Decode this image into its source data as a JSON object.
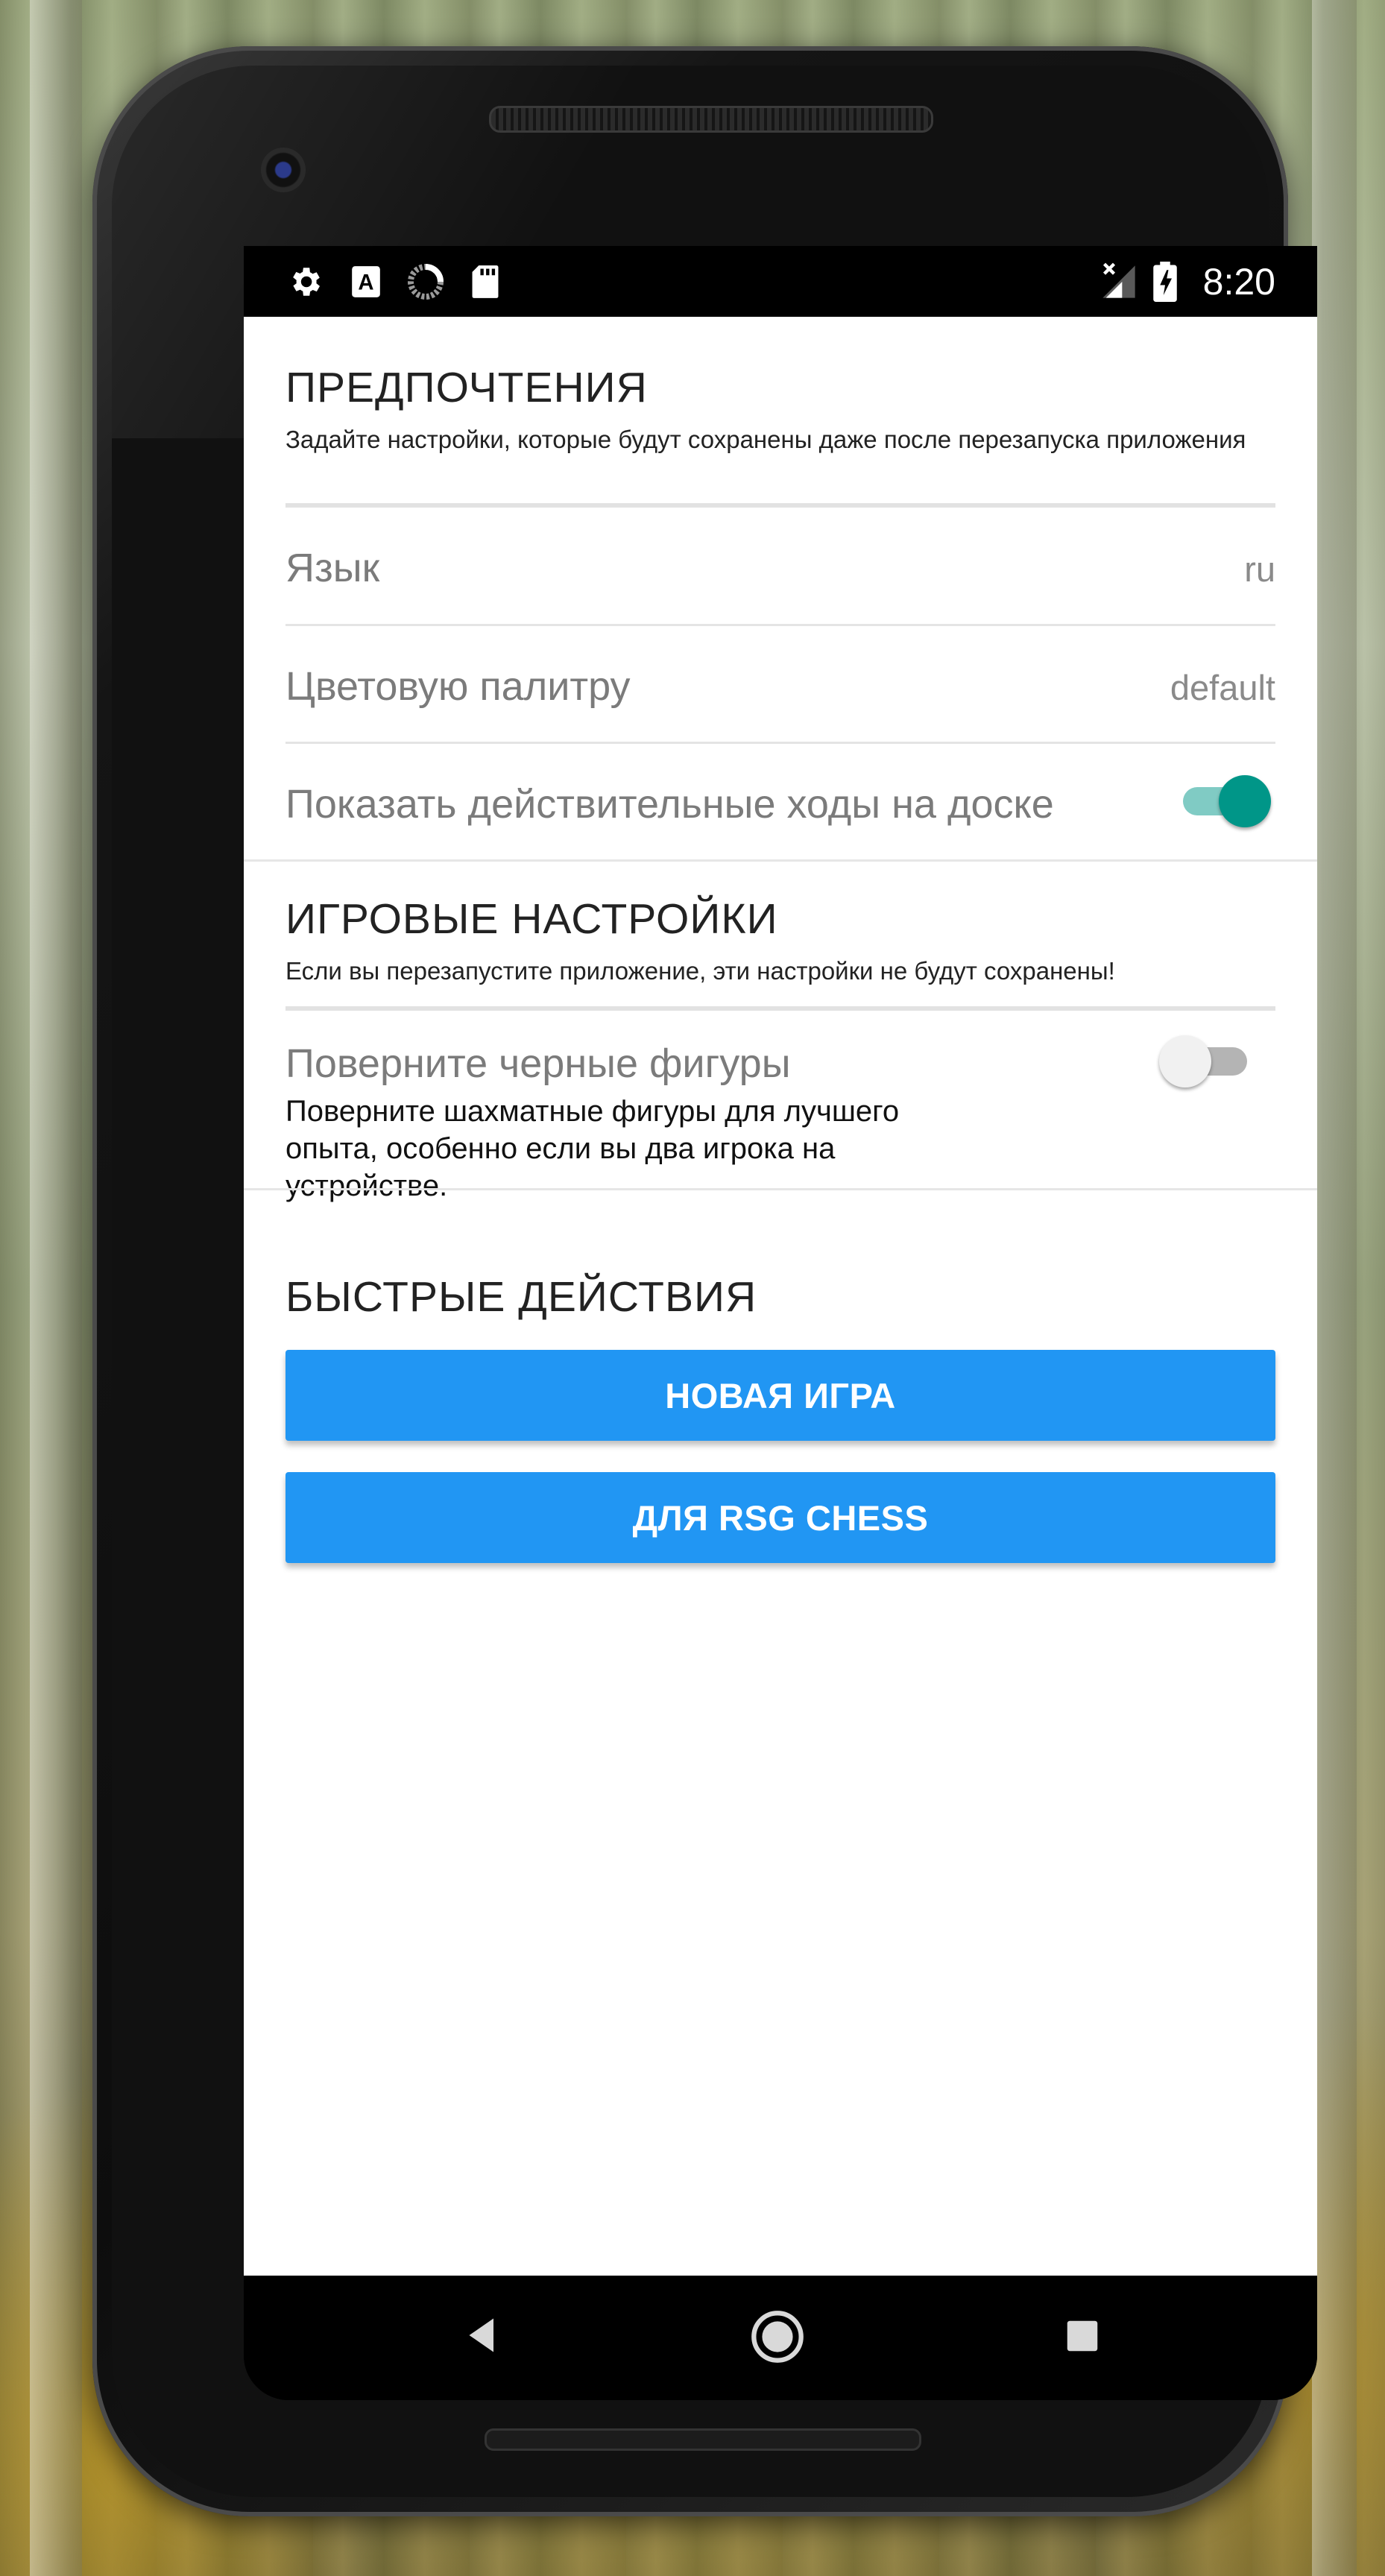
{
  "status_bar": {
    "icons_left": [
      "gear-icon",
      "text-a-icon",
      "sync-progress-icon",
      "sd-card-icon"
    ],
    "icons_right": [
      "no-signal-icon",
      "battery-charging-icon"
    ],
    "time": "8:20"
  },
  "preferences": {
    "title": "ПРЕДПОЧТЕНИЯ",
    "description": "Задайте настройки, которые будут сохранены даже после перезапуска приложения",
    "language": {
      "label": "Язык",
      "value": "ru"
    },
    "palette": {
      "label": "Цветовую палитру",
      "value": "default"
    },
    "show_moves": {
      "label": "Показать действительные ходы на доске",
      "enabled": true
    }
  },
  "game_settings": {
    "title": "ИГРОВЫЕ НАСТРОЙКИ",
    "description": "Если вы перезапустите приложение, эти настройки не будут сохранены!",
    "rotate_black": {
      "label": "Поверните черные фигуры",
      "description": "Поверните шахматные фигуры для лучшего опыта, особенно если вы два игрока на устройстве.",
      "enabled": false
    }
  },
  "quick_actions": {
    "title": "БЫСТРЫЕ ДЕЙСТВИЯ",
    "new_game": "НОВАЯ ИГРА",
    "about": "ДЛЯ RSG CHESS"
  },
  "navigation_bar": {
    "icons": [
      "back-icon",
      "home-icon",
      "recents-icon"
    ]
  },
  "colors": {
    "accent": "#2196f3",
    "switch_on": "#009688",
    "switch_on_track": "#80cbc4",
    "switch_off_thumb": "#f1f1f1",
    "switch_off_track": "#b4b4b4"
  }
}
